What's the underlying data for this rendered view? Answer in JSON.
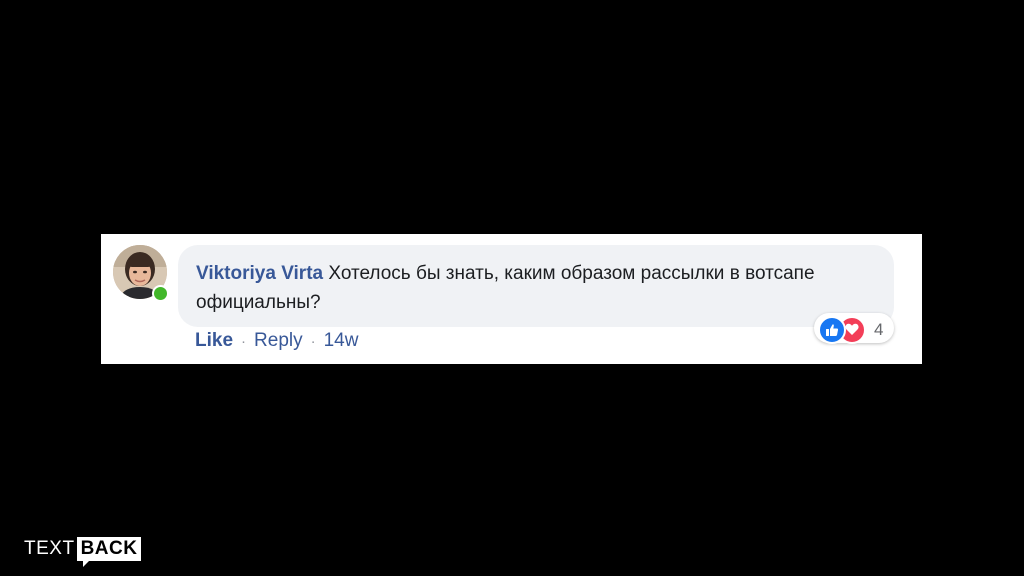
{
  "comment": {
    "author": "Viktoriya Virta",
    "text": "Хотелось бы знать, каким образом рассылки в вотсапе официальны?",
    "presence": "online",
    "reactions": {
      "icons": [
        "like-icon",
        "love-icon"
      ],
      "count": "4"
    },
    "actions": {
      "like_label": "Like",
      "reply_label": "Reply",
      "separator": "·",
      "timestamp": "14w"
    }
  },
  "brand": {
    "text_part": "TEXT",
    "boxed_part": "BACK"
  },
  "colors": {
    "background": "#000000",
    "card": "#ffffff",
    "bubble": "#f0f2f5",
    "link": "#385898",
    "like": "#1877f2",
    "love": "#f33e58",
    "online": "#42b72a"
  }
}
